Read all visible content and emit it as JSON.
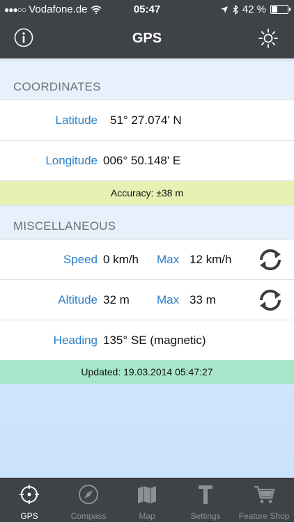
{
  "status_bar": {
    "carrier": "Vodafone.de",
    "time": "05:47",
    "battery": "42 %",
    "signal_icon": "signal-dots-icon",
    "wifi_icon": "wifi-icon",
    "location_icon": "location-arrow-icon",
    "bluetooth_icon": "bluetooth-icon",
    "battery_level": 0.42
  },
  "nav": {
    "title": "GPS",
    "left_icon": "info-icon",
    "right_icon": "brightness-icon"
  },
  "coordinates": {
    "header": "COORDINATES",
    "latitude_label": "Latitude",
    "latitude_value": "51° 27.074' N",
    "longitude_label": "Longitude",
    "longitude_value": "006° 50.148' E",
    "accuracy": "Accuracy: ±38 m"
  },
  "misc": {
    "header": "MISCELLANEOUS",
    "speed_label": "Speed",
    "speed_value": "0 km/h",
    "speed_max_label": "Max",
    "speed_max_value": "12 km/h",
    "altitude_label": "Altitude",
    "altitude_value": "32 m",
    "altitude_max_label": "Max",
    "altitude_max_value": "33 m",
    "heading_label": "Heading",
    "heading_value": "135° SE (magnetic)",
    "updated": "Updated: 19.03.2014 05:47:27"
  },
  "tabs": [
    {
      "label": "GPS",
      "icon": "crosshair-icon",
      "active": true
    },
    {
      "label": "Compass",
      "icon": "compass-icon",
      "active": false
    },
    {
      "label": "Map",
      "icon": "map-icon",
      "active": false
    },
    {
      "label": "Settings",
      "icon": "hammer-icon",
      "active": false
    },
    {
      "label": "Feature Shop",
      "icon": "cart-icon",
      "active": false
    }
  ],
  "colors": {
    "bar": "#3f4246",
    "label_blue": "#2a7fc6",
    "accuracy_bg": "#e6f1b3",
    "updated_bg": "#a8e6cb"
  }
}
